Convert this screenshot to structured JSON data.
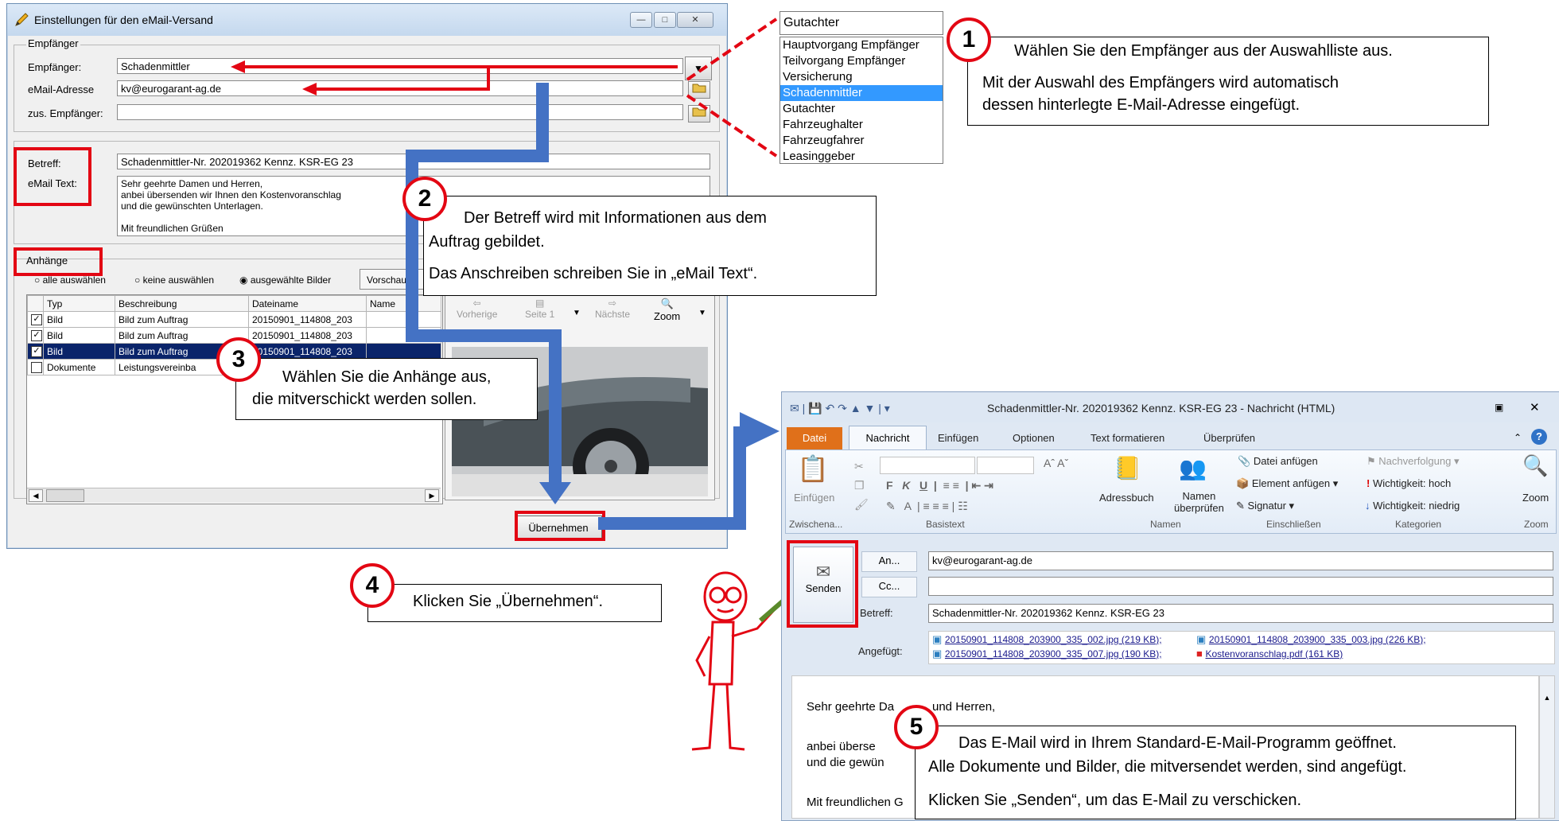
{
  "dialog": {
    "title": "Einstellungen für den eMail-Versand",
    "group_recipient": "Empfänger",
    "label_recipient": "Empfänger:",
    "recipient_value": "Schadenmittler",
    "label_email": "eMail-Adresse",
    "email_value": "kv@eurogarant-ag.de",
    "label_add_recipient": "zus. Empfänger:",
    "add_recipient_value": "",
    "label_subject": "Betreff:",
    "subject_value": "Schadenmittler-Nr. 202019362  Kennz. KSR-EG 23",
    "label_body": "eMail Text:",
    "body_lines": [
      "Sehr geehrte Damen und Herren,",
      "anbei übersenden wir Ihnen den Kostenvoranschlag",
      "und die gewünschten Unterlagen.",
      "",
      "Mit freundlichen Grüßen"
    ],
    "group_attachments": "Anhänge",
    "radio_all": "alle auswählen",
    "radio_none": "keine auswählen",
    "radio_selected": "ausgewählte Bilder",
    "preview_tab": "Vorschau",
    "table_headers": [
      "Typ",
      "Beschreibung",
      "Dateiname",
      "Name"
    ],
    "rows": [
      {
        "checked": true,
        "type": "Bild",
        "desc": "Bild zum Auftrag",
        "file": "20150901_114808_203"
      },
      {
        "checked": true,
        "type": "Bild",
        "desc": "Bild zum Auftrag",
        "file": "20150901_114808_203"
      },
      {
        "checked": true,
        "type": "Bild",
        "desc": "Bild zum Auftrag",
        "file": "20150901_114808_203"
      },
      {
        "checked": false,
        "type": "Dokumente",
        "desc": "Leistungsvereinba",
        "file": ""
      }
    ],
    "preview_prev": "Vorherige",
    "preview_page": "Seite 1",
    "preview_next": "Nächste",
    "preview_zoom": "Zoom",
    "apply_button": "Übernehmen"
  },
  "dropdown": {
    "current": "Gutachter",
    "options": [
      "Hauptvorgang Empfänger",
      "Teilvorgang Empfänger",
      "Versicherung",
      "Schadenmittler",
      "Gutachter",
      "Fahrzeughalter",
      "Fahrzeugfahrer",
      "Leasinggeber"
    ],
    "selected": "Schadenmittler"
  },
  "callouts": {
    "c1_num": "1",
    "c1_line1": "Wählen Sie den Empfänger aus der Auswahlliste aus.",
    "c1_line2": "Mit der Auswahl des Empfängers wird automatisch",
    "c1_line3": "dessen hinterlegte E-Mail-Adresse eingefügt.",
    "c2_num": "2",
    "c2_line1": "Der Betreff wird mit Informationen aus dem",
    "c2_line2": "Auftrag gebildet.",
    "c2_line3": "Das Anschreiben schreiben Sie in „eMail Text“.",
    "c3_num": "3",
    "c3_line1": "Wählen Sie die Anhänge aus,",
    "c3_line2": "die mitverschickt werden sollen.",
    "c4_num": "4",
    "c4_line1": "Klicken Sie „Übernehmen“.",
    "c5_num": "5",
    "c5_line1": "Das E-Mail wird in Ihrem Standard-E-Mail-Programm geöffnet.",
    "c5_line2": "Alle Dokumente und Bilder, die mitversendet werden, sind angefügt.",
    "c5_line3": "Klicken Sie „Senden“, um das E-Mail zu verschicken."
  },
  "outlook": {
    "title": "Schadenmittler-Nr. 202019362  Kennz. KSR-EG 23  -  Nachricht (HTML)",
    "tabs": [
      "Datei",
      "Nachricht",
      "Einfügen",
      "Optionen",
      "Text formatieren",
      "Überprüfen"
    ],
    "ribbon": {
      "paste": "Einfügen",
      "clipboard": "Zwischena...",
      "basictext": "Basistext",
      "addressbook": "Adressbuch",
      "checknames_1": "Namen",
      "checknames_2": "überprüfen",
      "names": "Namen",
      "attach_file": "Datei anfügen",
      "attach_item": "Element anfügen",
      "signature": "Signatur",
      "include": "Einschließen",
      "followup": "Nachverfolgung",
      "high": "Wichtigkeit: hoch",
      "low": "Wichtigkeit: niedrig",
      "categories": "Kategorien",
      "zoom": "Zoom",
      "zoom_group": "Zoom"
    },
    "send": "Senden",
    "to_btn": "An...",
    "to_value": "kv@eurogarant-ag.de",
    "cc_btn": "Cc...",
    "cc_value": "",
    "subject_label": "Betreff:",
    "subject_value": "Schadenmittler-Nr. 202019362  Kennz. KSR-EG 23",
    "attached_label": "Angefügt:",
    "attachments": [
      "20150901_114808_203900_335_002.jpg (219 KB);",
      "20150901_114808_203900_335_003.jpg (226 KB);",
      "20150901_114808_203900_335_007.jpg (190 KB);",
      "Kostenvoranschlag.pdf (161 KB)"
    ],
    "body_1": "Sehr geehrte Da",
    "body_1b": "und Herren,",
    "body_2": "anbei überse",
    "body_3": "und die gewün",
    "body_4": "Mit freundlichen G"
  }
}
